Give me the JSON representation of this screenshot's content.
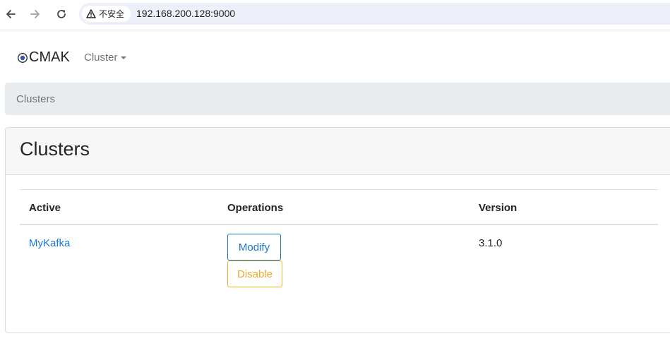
{
  "browser": {
    "security_label": "不安全",
    "url": "192.168.200.128:9000",
    "icons": [
      "back-arrow-icon",
      "forward-arrow-icon",
      "reload-icon",
      "warning-icon"
    ]
  },
  "navbar": {
    "brand": "CMAK",
    "cluster_menu": "Cluster"
  },
  "breadcrumb": {
    "current": "Clusters"
  },
  "card": {
    "title": "Clusters",
    "table": {
      "headers": [
        "Active",
        "Operations",
        "Version"
      ],
      "rows": [
        {
          "name": "MyKafka",
          "modify_label": "Modify",
          "disable_label": "Disable",
          "version": "3.1.0"
        }
      ]
    }
  },
  "colors": {
    "link": "#1a7ae0",
    "modify": "#1a73d0",
    "disable": "#f0a52a",
    "breadcrumb_bg": "#e9ecef"
  }
}
